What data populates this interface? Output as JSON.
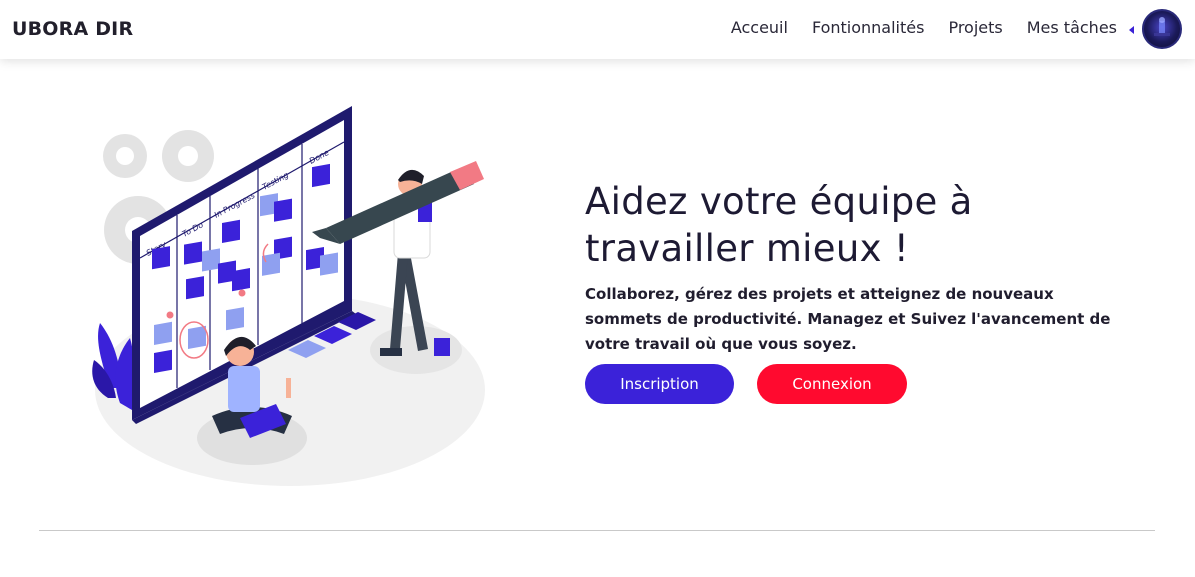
{
  "navbar": {
    "brand": "UBORA DIR",
    "links": [
      "Acceuil",
      "Fontionnalités",
      "Projets",
      "Mes tâches"
    ]
  },
  "hero": {
    "title_line1": "Aidez votre équipe à",
    "title_line2": "travailler mieux !",
    "subtitle": "Collaborez, gérez des projets et atteignez de nouveaux sommets de productivité. Managez et Suivez l'avancement de votre travail où que vous soyez.",
    "buttons": {
      "signup": "Inscription",
      "login": "Connexion"
    }
  },
  "illustration": {
    "board_columns": [
      "Story",
      "To Do",
      "In Progress",
      "Testing",
      "Done"
    ]
  },
  "colors": {
    "primary": "#3b22d9",
    "danger": "#ff0a2f",
    "board_frame": "#1f1a6e"
  }
}
